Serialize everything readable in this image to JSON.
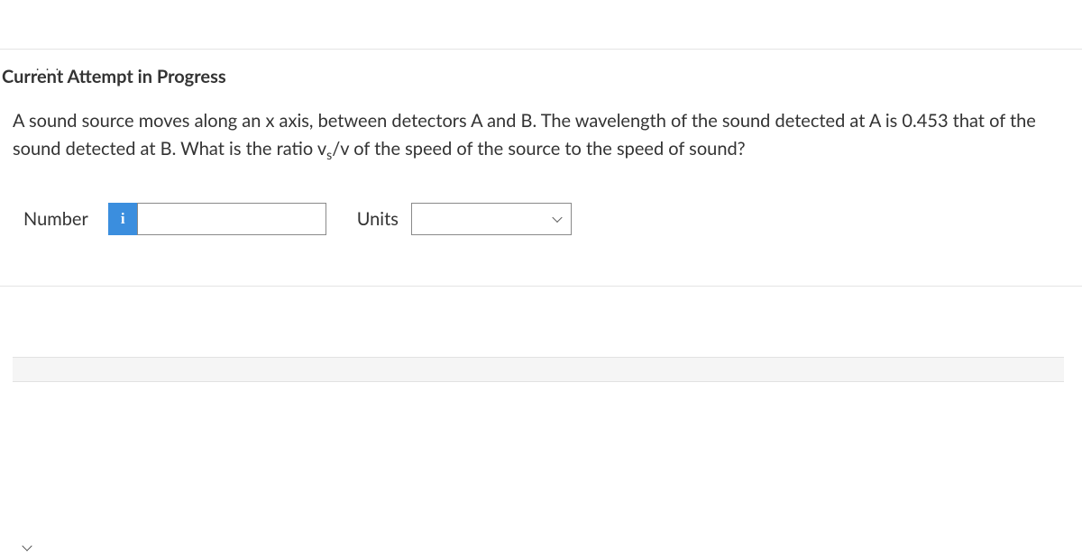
{
  "top_dots": ". . .",
  "heading": "Current Attempt in Progress",
  "question_prefix": "A sound source moves along an x axis, between detectors A and B. The wavelength of the sound detected at A is 0.453 that of the sound detected at B. What is the ratio v",
  "question_sub": "s",
  "question_suffix": "/v of the speed of the source to the speed of sound?",
  "number_label": "Number",
  "info_badge": "i",
  "number_value": "",
  "number_placeholder": "",
  "units_label": "Units",
  "units_value": "",
  "units_placeholder": ""
}
